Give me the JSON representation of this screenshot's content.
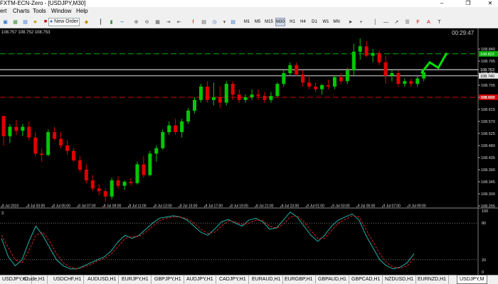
{
  "window": {
    "title": "FXTM-ECN-Zero - [USDJPY,M30]",
    "min_icon": "minimize-icon",
    "restore_icon": "restore-icon",
    "close_icon": "close-icon"
  },
  "menu": [
    "ert",
    "Charts",
    "Tools",
    "Window",
    "Help"
  ],
  "toolbar": {
    "new_order_label": "New Order",
    "timeframes": [
      "M1",
      "M5",
      "M15",
      "M30",
      "H1",
      "H4",
      "D1",
      "W1",
      "MN"
    ],
    "active_timeframe": "M30"
  },
  "chart": {
    "ohlc_text": "108.757 108.752 108.753",
    "countdown": "00:29:47",
    "bg_color": "#000000",
    "bull_color": "#00c800",
    "bear_color": "#e00000",
    "green_level_color": "#00b000",
    "red_level_color": "#d00000",
    "price_ticks": [
      "108.840",
      "108.795",
      "108.750",
      "108.705",
      "108.660",
      "108.615",
      "108.570",
      "108.525",
      "108.480",
      "108.435",
      "108.390",
      "108.345",
      "108.300",
      "108.255"
    ],
    "level_labels": {
      "green_line": "108.822",
      "ask": "108.763",
      "bid": "108.740",
      "red_line": "108.660"
    },
    "time_labels": [
      "8 Jul 2019",
      "8 Jul 03:00",
      "8 Jul 05:00",
      "8 Jul 07:00",
      "8 Jul 09:00",
      "8 Jul 11:00",
      "8 Jul 13:00",
      "8 Jul 15:00",
      "8 Jul 17:00",
      "8 Jul 19:00",
      "8 Jul 21:00",
      "8 Jul 23:00",
      "9 Jul 01:00",
      "9 Jul 03:00",
      "9 Jul 05:00",
      "9 Jul 07:00",
      "9 Jul 09:00"
    ],
    "osc_label": "3",
    "osc_ticks": [
      "100",
      "80",
      "20",
      "0"
    ]
  },
  "chart_data": {
    "type": "candlestick",
    "symbol": "USDJPY",
    "timeframe": "M30",
    "price_range": [
      108.255,
      108.885
    ],
    "levels": {
      "green_dashed": 108.822,
      "ask": 108.763,
      "bid": 108.74,
      "red_dashed": 108.66
    },
    "candles": [
      [
        108.59,
        108.59,
        108.48,
        108.515
      ],
      [
        108.515,
        108.56,
        108.49,
        108.55
      ],
      [
        108.55,
        108.575,
        108.52,
        108.535
      ],
      [
        108.535,
        108.56,
        108.515,
        108.55
      ],
      [
        108.55,
        108.57,
        108.5,
        108.51
      ],
      [
        108.51,
        108.53,
        108.44,
        108.45
      ],
      [
        108.45,
        108.47,
        108.42,
        108.445
      ],
      [
        108.445,
        108.54,
        108.44,
        108.53
      ],
      [
        108.53,
        108.55,
        108.5,
        108.505
      ],
      [
        108.505,
        108.53,
        108.47,
        108.48
      ],
      [
        108.48,
        108.5,
        108.445,
        108.46
      ],
      [
        108.46,
        108.47,
        108.42,
        108.425
      ],
      [
        108.425,
        108.44,
        108.38,
        108.39
      ],
      [
        108.39,
        108.41,
        108.34,
        108.35
      ],
      [
        108.35,
        108.37,
        108.31,
        108.32
      ],
      [
        108.32,
        108.335,
        108.295,
        108.31
      ],
      [
        108.31,
        108.32,
        108.27,
        108.29
      ],
      [
        108.29,
        108.36,
        108.28,
        108.35
      ],
      [
        108.35,
        108.365,
        108.32,
        108.33
      ],
      [
        108.33,
        108.35,
        108.315,
        108.345
      ],
      [
        108.345,
        108.36,
        108.33,
        108.34
      ],
      [
        108.34,
        108.42,
        108.335,
        108.41
      ],
      [
        108.41,
        108.44,
        108.36,
        108.37
      ],
      [
        108.37,
        108.46,
        108.365,
        108.45
      ],
      [
        108.45,
        108.48,
        108.42,
        108.47
      ],
      [
        108.47,
        108.54,
        108.465,
        108.53
      ],
      [
        108.53,
        108.57,
        108.52,
        108.555
      ],
      [
        108.555,
        108.58,
        108.52,
        108.53
      ],
      [
        108.53,
        108.58,
        108.51,
        108.57
      ],
      [
        108.57,
        108.62,
        108.56,
        108.61
      ],
      [
        108.61,
        108.66,
        108.6,
        108.65
      ],
      [
        108.65,
        108.71,
        108.64,
        108.7
      ],
      [
        108.7,
        108.72,
        108.64,
        108.65
      ],
      [
        108.65,
        108.715,
        108.63,
        108.66
      ],
      [
        108.66,
        108.7,
        108.62,
        108.64
      ],
      [
        108.64,
        108.72,
        108.63,
        108.71
      ],
      [
        108.71,
        108.72,
        108.65,
        108.67
      ],
      [
        108.67,
        108.69,
        108.64,
        108.65
      ],
      [
        108.65,
        108.67,
        108.64,
        108.66
      ],
      [
        108.66,
        108.69,
        108.65,
        108.67
      ],
      [
        108.67,
        108.69,
        108.65,
        108.665
      ],
      [
        108.665,
        108.68,
        108.64,
        108.65
      ],
      [
        108.65,
        108.68,
        108.64,
        108.665
      ],
      [
        108.665,
        108.715,
        108.66,
        108.71
      ],
      [
        108.71,
        108.76,
        108.7,
        108.75
      ],
      [
        108.75,
        108.79,
        108.74,
        108.78
      ],
      [
        108.78,
        108.79,
        108.74,
        108.745
      ],
      [
        108.745,
        108.76,
        108.7,
        108.715
      ],
      [
        108.715,
        108.74,
        108.69,
        108.7
      ],
      [
        108.7,
        108.715,
        108.68,
        108.69
      ],
      [
        108.69,
        108.71,
        108.67,
        108.705
      ],
      [
        108.705,
        108.725,
        108.69,
        108.7
      ],
      [
        108.7,
        108.74,
        108.69,
        108.735
      ],
      [
        108.735,
        108.75,
        108.71,
        108.72
      ],
      [
        108.72,
        108.77,
        108.71,
        108.76
      ],
      [
        108.76,
        108.86,
        108.74,
        108.83
      ],
      [
        108.83,
        108.88,
        108.8,
        108.85
      ],
      [
        108.85,
        108.87,
        108.81,
        108.815
      ],
      [
        108.815,
        108.84,
        108.79,
        108.825
      ],
      [
        108.825,
        108.835,
        108.78,
        108.79
      ],
      [
        108.79,
        108.815,
        108.71,
        108.74
      ],
      [
        108.74,
        108.76,
        108.72,
        108.75
      ],
      [
        108.75,
        108.76,
        108.7,
        108.71
      ],
      [
        108.71,
        108.73,
        108.7,
        108.72
      ],
      [
        108.72,
        108.73,
        108.7,
        108.71
      ],
      [
        108.71,
        108.74,
        108.7,
        108.73
      ],
      [
        108.73,
        108.765,
        108.72,
        108.753
      ]
    ],
    "projection_arrow": [
      [
        108.75,
        108.79,
        108.77,
        108.825
      ]
    ],
    "stochastic": {
      "range": [
        0,
        100
      ],
      "levels": [
        80,
        20
      ],
      "main": [
        55,
        25,
        10,
        20,
        50,
        75,
        60,
        40,
        20,
        10,
        5,
        5,
        10,
        15,
        20,
        25,
        35,
        50,
        60,
        55,
        60,
        70,
        80,
        88,
        90,
        92,
        90,
        85,
        75,
        65,
        60,
        70,
        82,
        86,
        80,
        75,
        85,
        88,
        82,
        70,
        72,
        85,
        98,
        90,
        75,
        60,
        50,
        60,
        75,
        85,
        90,
        95,
        85,
        60,
        40,
        20,
        10,
        5,
        8,
        15,
        30
      ],
      "signal": [
        60,
        40,
        20,
        15,
        35,
        60,
        65,
        50,
        30,
        15,
        8,
        5,
        8,
        12,
        18,
        22,
        30,
        42,
        55,
        58,
        58,
        65,
        75,
        84,
        88,
        90,
        90,
        87,
        80,
        70,
        63,
        65,
        75,
        84,
        82,
        78,
        80,
        85,
        84,
        75,
        72,
        78,
        90,
        92,
        82,
        68,
        55,
        55,
        68,
        80,
        86,
        92,
        90,
        70,
        50,
        30,
        15,
        8,
        6,
        10,
        22
      ]
    }
  },
  "tabs": [
    "USDJPY,H1",
    "Crude,H1",
    "USDCHF,H1",
    "AUDUSD,H1",
    "EURJPY,H1",
    "GBPJPY,H1",
    "AUDJPY,H1",
    "CADJPY,H1",
    "EURAUD,H1",
    "EURGBP,H1",
    "GBPAUD,H1",
    "GBPCAD,H1",
    "NZDUSD,H1",
    "EURNZD,H1",
    "USDJPY,M30"
  ],
  "active_tab_index": 14,
  "tab_display": [
    "USDJPY,H1",
    "Crude,H1",
    "USDCHF,H1",
    "AUDUSD,H1",
    "EURJPY,H1",
    "GBPJPY,H1",
    "AUDJPY,H1",
    "CADJPY,H1",
    "EURAUD,H1",
    "EURGBP,H1",
    "GBPAUD,H1",
    "GBPCAD,H1",
    "NZDUSD,H1",
    "EURNZD,H1",
    "USDJPY,M"
  ]
}
